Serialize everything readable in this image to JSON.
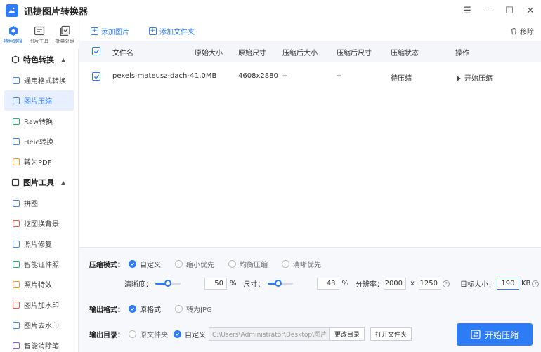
{
  "app": {
    "title": "迅捷图片转换器",
    "window_controls": {
      "menu": "☰",
      "minimize": "—",
      "maximize": "☐",
      "close": "✕"
    }
  },
  "iconbar": [
    {
      "label": "特色转换",
      "icon": "convert-icon",
      "active": true
    },
    {
      "label": "图片工具",
      "icon": "image-tools-icon",
      "active": false
    },
    {
      "label": "批量处理",
      "icon": "batch-icon",
      "active": false
    }
  ],
  "sidebar": {
    "sections": [
      {
        "title": "特色转换",
        "items": [
          {
            "label": "通用格式转换"
          },
          {
            "label": "图片压缩",
            "active": true
          },
          {
            "label": "Raw转换"
          },
          {
            "label": "Heic转换"
          },
          {
            "label": "转为PDF"
          }
        ]
      },
      {
        "title": "图片工具",
        "items": [
          {
            "label": "拼图"
          },
          {
            "label": "抠图换背景"
          },
          {
            "label": "照片修复"
          },
          {
            "label": "智能证件照"
          },
          {
            "label": "照片特效"
          },
          {
            "label": "图片加水印"
          },
          {
            "label": "图片去水印"
          },
          {
            "label": "智能消除笔"
          }
        ]
      }
    ]
  },
  "toolbar": {
    "add_image": "添加图片",
    "add_folder": "添加文件夹",
    "remove": "移除"
  },
  "table": {
    "columns": [
      "文件名",
      "原始大小",
      "原始尺寸",
      "压缩后大小",
      "压缩后尺寸",
      "压缩状态",
      "操作"
    ],
    "rows": [
      {
        "name": "pexels-mateusz-dach-45...",
        "size": "1.0MB",
        "dims": "4608x2880",
        "new_size": "--",
        "new_dims": "--",
        "status": "待压缩",
        "action": "开始压缩"
      }
    ]
  },
  "settings": {
    "mode_label": "压缩模式：",
    "modes": [
      {
        "label": "自定义",
        "selected": true
      },
      {
        "label": "缩小优先",
        "selected": false
      },
      {
        "label": "均衡压缩",
        "selected": false
      },
      {
        "label": "清晰优先",
        "selected": false
      }
    ],
    "clarity_label": "清晰度：",
    "clarity_value": "50",
    "clarity_unit": "%",
    "clarity_percent": 50,
    "size_label": "尺寸：",
    "size_value": "43",
    "size_unit": "%",
    "size_percent": 43,
    "resolution_label": "分辨率：",
    "res_width": "2000",
    "res_x": "x",
    "res_height": "1250",
    "target_label": "目标大小：",
    "target_value": "190",
    "target_unit": "KB",
    "help": "?",
    "format_label": "输出格式：",
    "formats": [
      {
        "label": "原格式",
        "selected": true
      },
      {
        "label": "转为JPG",
        "selected": false
      }
    ],
    "output_label": "输出目录：",
    "outputs": [
      {
        "label": "原文件夹",
        "selected": false
      },
      {
        "label": "自定义",
        "selected": true
      }
    ],
    "path": "C:\\Users\\Administrator\\Desktop\\图片",
    "change_dir": "更改目录",
    "open_folder": "打开文件夹",
    "start": "开始压缩"
  },
  "colors": {
    "accent": "#2d7cf6",
    "sidebar_active_bg": "#e8efff"
  }
}
